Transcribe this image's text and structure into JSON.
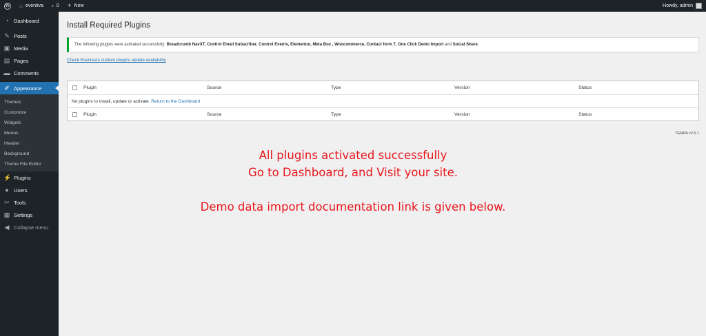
{
  "adminbar": {
    "site_name": "eventiva",
    "comments_count": "0",
    "new_label": "New",
    "howdy": "Howdy, admin"
  },
  "sidebar": {
    "items": [
      {
        "label": "Dashboard",
        "icon": "dashboard-icon"
      },
      {
        "label": "Posts",
        "icon": "pin-icon"
      },
      {
        "label": "Media",
        "icon": "media-icon"
      },
      {
        "label": "Pages",
        "icon": "pages-icon"
      },
      {
        "label": "Comments",
        "icon": "comments-icon"
      },
      {
        "label": "Appearance",
        "icon": "appearance-icon"
      },
      {
        "label": "Plugins",
        "icon": "plugins-icon"
      },
      {
        "label": "Users",
        "icon": "users-icon"
      },
      {
        "label": "Tools",
        "icon": "tools-icon"
      },
      {
        "label": "Settings",
        "icon": "settings-icon"
      },
      {
        "label": "Collapse menu",
        "icon": "collapse-icon"
      }
    ],
    "submenu": [
      "Themes",
      "Customize",
      "Widgets",
      "Menus",
      "Header",
      "Background",
      "Theme File Editor"
    ]
  },
  "main": {
    "title": "Install Required Plugins",
    "notice_prefix": "The following plugins were activated successfully:",
    "notice_plugins": "Breadcrumb NavXT, Control Email Subscriber, Control Events, Elementor, Meta Box , Woocommerce, Contact form 7, One Click Demo Import",
    "notice_and": "and",
    "notice_last": "Social Share",
    "notice_end": ".",
    "check_link": "Check Eventiva's custom plugins update availability",
    "table": {
      "headers": [
        "Plugin",
        "Source",
        "Type",
        "Version",
        "Status"
      ],
      "empty_text": "No plugins to install, update or activate.",
      "empty_link": "Return to the Dashboard"
    },
    "version_tag": "TGMPA v2.6.1"
  },
  "overlay": {
    "line1": "All plugins activated successfully",
    "line2": "Go to Dashboard, and Visit your site.",
    "line3": "Demo data import documentation link is given below."
  },
  "colors": {
    "admin_bg": "#1d2327",
    "accent": "#2271b1",
    "success": "#00a32a",
    "overlay_text": "#e8171c"
  }
}
